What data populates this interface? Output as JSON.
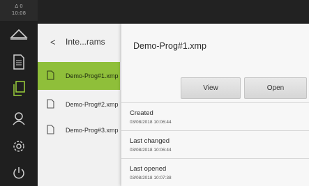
{
  "status": {
    "line1": "Δ 0",
    "line2": "10:08"
  },
  "rail": {
    "icons": [
      "machine-icon",
      "document-icon",
      "copy-icon",
      "user-icon",
      "settings-icon",
      "power-icon"
    ]
  },
  "list": {
    "back_label": "<",
    "title": "Inte...rams",
    "items": [
      {
        "name": "Demo-Prog#1.xmp",
        "selected": true
      },
      {
        "name": "Demo-Prog#2.xmp",
        "selected": false
      },
      {
        "name": "Demo-Prog#3.xmp",
        "selected": false
      }
    ]
  },
  "detail": {
    "title": "Demo-Prog#1.xmp",
    "view_label": "View",
    "open_label": "Open",
    "properties": [
      {
        "label": "Created",
        "value": "03/08/2018 10:06:44"
      },
      {
        "label": "Last changed",
        "value": "03/08/2018 10:06:44"
      },
      {
        "label": "Last opened",
        "value": "03/08/2018 10:07:38"
      }
    ]
  },
  "colors": {
    "selected": "#8fbf3a",
    "rail": "#1f1f1f"
  }
}
